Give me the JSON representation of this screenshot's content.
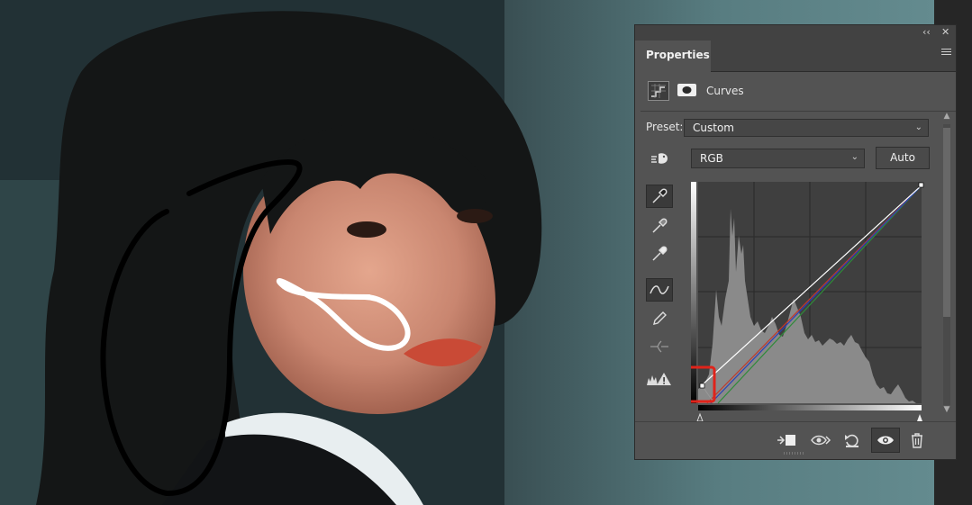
{
  "canvas": {
    "content": "photo-with-annotations"
  },
  "panel": {
    "title_controls": {
      "collapse": "‹‹",
      "close": "✕"
    },
    "tab_label": "Properties",
    "adjustment_label": "Curves",
    "preset_label": "Preset:",
    "preset_value": "Custom",
    "channel_value": "RGB",
    "auto_label": "Auto",
    "tools": [
      "targeted-adjustment-icon",
      "black-point-eyedropper-icon",
      "gray-point-eyedropper-icon",
      "white-point-eyedropper-icon",
      "curve-points-icon",
      "pencil-icon",
      "smooth-icon",
      "clipping-warning-icon"
    ],
    "bottom_buttons": [
      "clip-to-layer-icon",
      "view-previous-state-icon",
      "reset-icon",
      "visibility-eye-icon",
      "trash-icon"
    ]
  },
  "colors": {
    "panel_bg": "#535353",
    "highlight_box": "#e0231a",
    "curve_red": "#c0392b",
    "curve_green": "#2e8b3a",
    "curve_blue": "#2b3fb5",
    "curve_rgb": "#ffffff"
  }
}
